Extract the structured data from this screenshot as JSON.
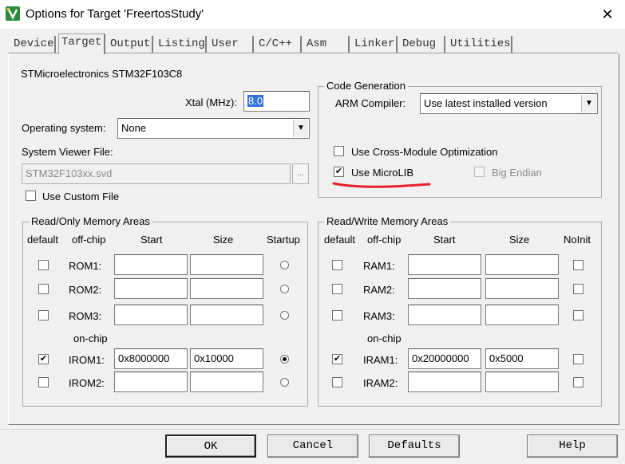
{
  "window": {
    "title": "Options for Target 'FreertosStudy'"
  },
  "tabs": [
    "Device",
    "Target",
    "Output",
    "Listing",
    "User",
    "C/C++",
    "Asm",
    "Linker",
    "Debug",
    "Utilities"
  ],
  "target": {
    "device_name": "STMicroelectronics STM32F103C8",
    "xtal_label": "Xtal (MHz):",
    "xtal_value": "8.0",
    "os_label": "Operating system:",
    "os_value": "None",
    "svd_label": "System Viewer File:",
    "svd_value": "STM32F103xx.svd",
    "svd_browse": "...",
    "custom_file_label": "Use Custom File"
  },
  "code_generation": {
    "title": "Code Generation",
    "arm_compiler_label": "ARM Compiler:",
    "arm_compiler_value": "Use latest installed version",
    "cross_module_label": "Use Cross-Module Optimization",
    "microlib_label": "Use MicroLIB",
    "big_endian_label": "Big Endian"
  },
  "rom": {
    "title": "Read/Only Memory Areas",
    "headers": {
      "default": "default",
      "offchip": "off-chip",
      "start": "Start",
      "size": "Size",
      "startup": "Startup"
    },
    "onchip_label": "on-chip",
    "rows": [
      {
        "label": "ROM1:",
        "start": "",
        "size": "",
        "default": false,
        "startup": false
      },
      {
        "label": "ROM2:",
        "start": "",
        "size": "",
        "default": false,
        "startup": false
      },
      {
        "label": "ROM3:",
        "start": "",
        "size": "",
        "default": false,
        "startup": false
      },
      {
        "label": "IROM1:",
        "start": "0x8000000",
        "size": "0x10000",
        "default": true,
        "startup": true
      },
      {
        "label": "IROM2:",
        "start": "",
        "size": "",
        "default": false,
        "startup": false
      }
    ]
  },
  "ram": {
    "title": "Read/Write Memory Areas",
    "headers": {
      "default": "default",
      "offchip": "off-chip",
      "start": "Start",
      "size": "Size",
      "noinit": "NoInit"
    },
    "onchip_label": "on-chip",
    "rows": [
      {
        "label": "RAM1:",
        "start": "",
        "size": "",
        "default": false,
        "noinit": false
      },
      {
        "label": "RAM2:",
        "start": "",
        "size": "",
        "default": false,
        "noinit": false
      },
      {
        "label": "RAM3:",
        "start": "",
        "size": "",
        "default": false,
        "noinit": false
      },
      {
        "label": "IRAM1:",
        "start": "0x20000000",
        "size": "0x5000",
        "default": true,
        "noinit": false
      },
      {
        "label": "IRAM2:",
        "start": "",
        "size": "",
        "default": false,
        "noinit": false
      }
    ]
  },
  "buttons": {
    "ok": "OK",
    "cancel": "Cancel",
    "defaults": "Defaults",
    "help": "Help"
  },
  "colors": {
    "annotation": "#e8202a",
    "selection": "#3371d6"
  }
}
